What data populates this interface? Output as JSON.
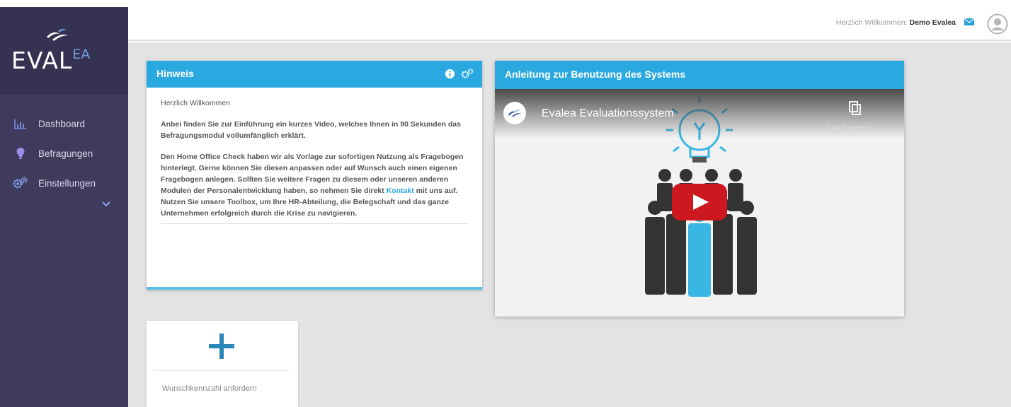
{
  "brand": {
    "logo_text": "EVAL",
    "logo_sup": "EA"
  },
  "sidebar": {
    "items": [
      {
        "label": "Dashboard",
        "icon": "chart-icon"
      },
      {
        "label": "Befragungen",
        "icon": "lightbulb-icon"
      },
      {
        "label": "Einstellungen",
        "icon": "gears-icon"
      }
    ]
  },
  "header": {
    "welcome_prefix": "Herzlich Willkommen:",
    "user_name": "Demo Evalea"
  },
  "hinweis": {
    "title": "Hinweis",
    "greeting": "Herzlich Willkommen",
    "para1": "Anbei finden Sie zur Einführung ein kurzes Video, welches Ihnen in 90 Sekunden das Befragungsmodul vollumfänglich erklärt.",
    "para2_before": "Den Home Office Check haben wir als Vorlage zur sofortigen Nutzung als Fragebogen hinterlegt. Gerne können Sie diesen anpassen oder auf Wunsch auch einen eigenen Fragebogen anlegen. Sollten Sie weitere Fragen zu diesem oder unseren anderen Modulen der Personalentwicklung haben, so nehmen Sie direkt ",
    "link": "Kontakt",
    "para2_after": " mit uns auf. Nutzen Sie unsere Toolbox, um Ihre HR-Abteilung, die Belegschaft und das ganze Unternehmen erfolgreich durch die Krise zu navigieren."
  },
  "video_card": {
    "title": "Anleitung zur Benutzung des Systems",
    "video_title": "Evalea Evaluationssystem",
    "copy_label": "Link kopieren"
  },
  "add_card": {
    "label": "Wunschkennzahl anfordern"
  },
  "colors": {
    "sidebar": "#3e3b5c",
    "accent": "#2aa9e0",
    "play": "#cc181e"
  }
}
